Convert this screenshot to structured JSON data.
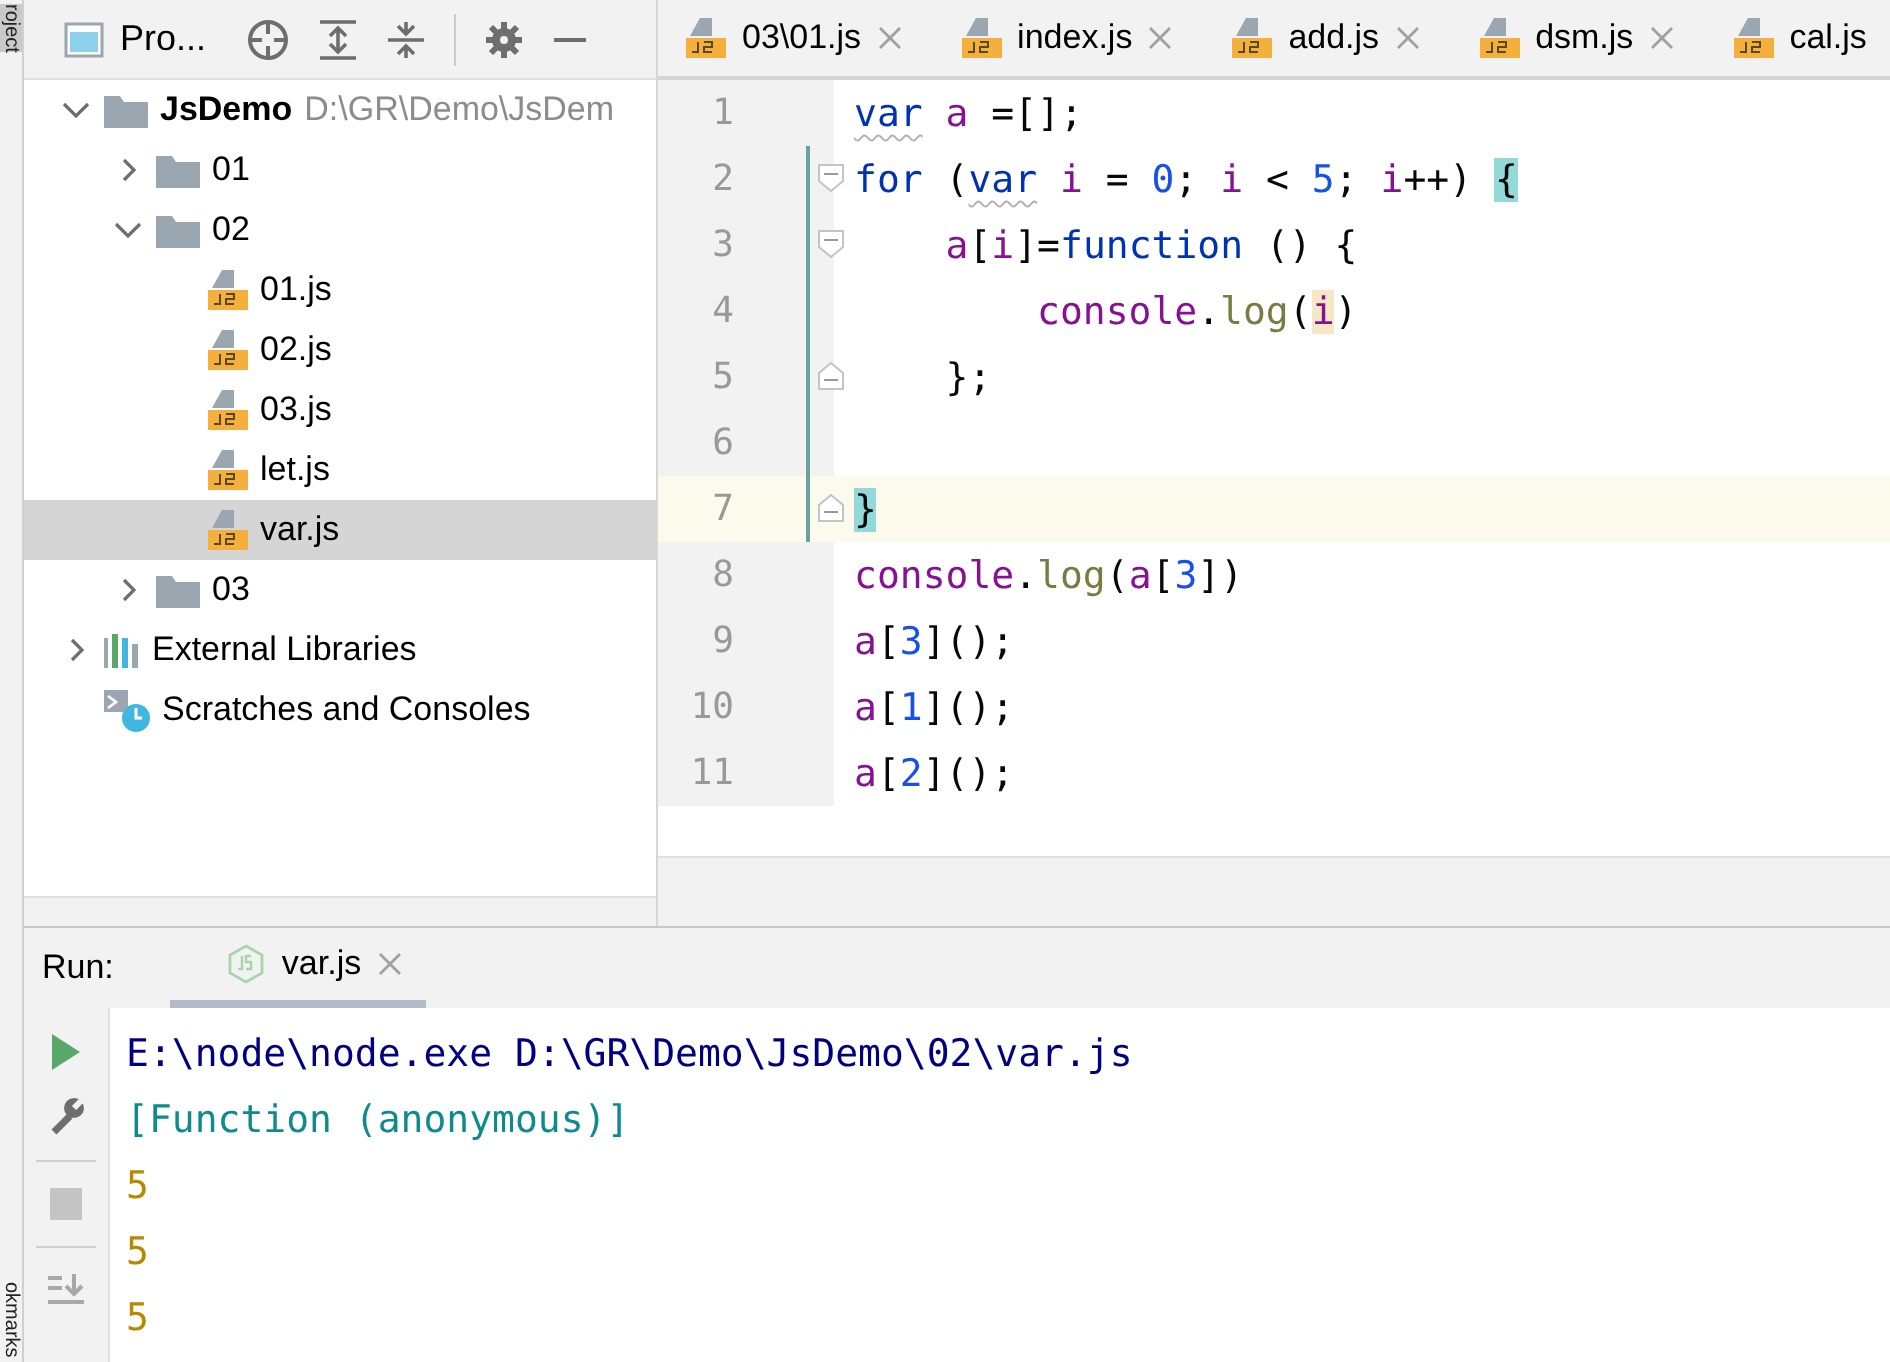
{
  "left_stripe": {
    "top_label": "roject",
    "bottom_label": "okmarks"
  },
  "project": {
    "title": "Pro...",
    "tree": [
      {
        "label": "JsDemo",
        "kind": "module",
        "path": "D:\\GR\\Demo\\JsDem",
        "expanded": true,
        "selected": false,
        "children": [
          {
            "label": "01",
            "kind": "folder",
            "expanded": false,
            "selected": false
          },
          {
            "label": "02",
            "kind": "folder",
            "expanded": true,
            "selected": false,
            "children": [
              {
                "label": "01.js",
                "kind": "js",
                "selected": false
              },
              {
                "label": "02.js",
                "kind": "js",
                "selected": false
              },
              {
                "label": "03.js",
                "kind": "js",
                "selected": false
              },
              {
                "label": "let.js",
                "kind": "js",
                "selected": false
              },
              {
                "label": "var.js",
                "kind": "js",
                "selected": true
              }
            ]
          },
          {
            "label": "03",
            "kind": "folder",
            "expanded": false,
            "selected": false
          }
        ]
      },
      {
        "label": "External Libraries",
        "kind": "libraries",
        "expanded": false,
        "selected": false
      },
      {
        "label": "Scratches and Consoles",
        "kind": "scratches",
        "selected": false
      }
    ]
  },
  "editor": {
    "tabs": [
      {
        "label": "03\\01.js",
        "closable": true
      },
      {
        "label": "index.js",
        "closable": true
      },
      {
        "label": "add.js",
        "closable": true
      },
      {
        "label": "dsm.js",
        "closable": true
      },
      {
        "label": "cal.js",
        "closable": false
      }
    ],
    "lines": [
      {
        "number": "1",
        "current": false,
        "changed": false,
        "tokens": [
          {
            "text": "var",
            "kind": "keyword",
            "warn": true
          },
          {
            "text": " a",
            "kind": "variable"
          },
          {
            "text": " =[];",
            "kind": "plain"
          }
        ]
      },
      {
        "number": "2",
        "current": false,
        "changed": true,
        "fold_open": true,
        "tokens": [
          {
            "text": "for",
            "kind": "keyword"
          },
          {
            "text": " (",
            "kind": "plain"
          },
          {
            "text": "var",
            "kind": "keyword",
            "warn": true
          },
          {
            "text": " i",
            "kind": "variable"
          },
          {
            "text": " = ",
            "kind": "plain"
          },
          {
            "text": "0",
            "kind": "number"
          },
          {
            "text": "; ",
            "kind": "plain"
          },
          {
            "text": "i",
            "kind": "variable"
          },
          {
            "text": " < ",
            "kind": "plain"
          },
          {
            "text": "5",
            "kind": "number"
          },
          {
            "text": "; ",
            "kind": "plain"
          },
          {
            "text": "i",
            "kind": "variable"
          },
          {
            "text": "++) ",
            "kind": "plain"
          },
          {
            "text": "{",
            "kind": "plain",
            "brace_match": true
          }
        ]
      },
      {
        "number": "3",
        "current": false,
        "changed": true,
        "fold_open": true,
        "tokens": [
          {
            "text": "    a",
            "kind": "variable"
          },
          {
            "text": "[",
            "kind": "plain"
          },
          {
            "text": "i",
            "kind": "variable"
          },
          {
            "text": "]=",
            "kind": "plain"
          },
          {
            "text": "function",
            "kind": "keyword"
          },
          {
            "text": " () {",
            "kind": "plain"
          }
        ]
      },
      {
        "number": "4",
        "current": false,
        "changed": true,
        "tokens": [
          {
            "text": "        console",
            "kind": "variable"
          },
          {
            "text": ".",
            "kind": "plain"
          },
          {
            "text": "log",
            "kind": "method"
          },
          {
            "text": "(",
            "kind": "plain"
          },
          {
            "text": "i",
            "kind": "variable",
            "usage_highlight": true
          },
          {
            "text": ")",
            "kind": "plain"
          }
        ]
      },
      {
        "number": "5",
        "current": false,
        "changed": true,
        "fold_close": true,
        "tokens": [
          {
            "text": "    };",
            "kind": "plain"
          }
        ]
      },
      {
        "number": "6",
        "current": false,
        "changed": true
      },
      {
        "number": "7",
        "current": true,
        "changed": true,
        "fold_close": true,
        "tokens": [
          {
            "text": "}",
            "kind": "plain",
            "brace_match": true
          }
        ]
      },
      {
        "number": "8",
        "current": false,
        "changed": false,
        "tokens": [
          {
            "text": "console",
            "kind": "variable"
          },
          {
            "text": ".",
            "kind": "plain"
          },
          {
            "text": "log",
            "kind": "method"
          },
          {
            "text": "(",
            "kind": "plain"
          },
          {
            "text": "a",
            "kind": "variable"
          },
          {
            "text": "[",
            "kind": "plain"
          },
          {
            "text": "3",
            "kind": "number"
          },
          {
            "text": "])",
            "kind": "plain"
          }
        ]
      },
      {
        "number": "9",
        "current": false,
        "changed": false,
        "tokens": [
          {
            "text": "a",
            "kind": "variable"
          },
          {
            "text": "[",
            "kind": "plain"
          },
          {
            "text": "3",
            "kind": "number"
          },
          {
            "text": "]();",
            "kind": "plain"
          }
        ]
      },
      {
        "number": "10",
        "current": false,
        "changed": false,
        "tokens": [
          {
            "text": "a",
            "kind": "variable"
          },
          {
            "text": "[",
            "kind": "plain"
          },
          {
            "text": "1",
            "kind": "number"
          },
          {
            "text": "]();",
            "kind": "plain"
          }
        ]
      },
      {
        "number": "11",
        "current": false,
        "changed": false,
        "tokens": [
          {
            "text": "a",
            "kind": "variable"
          },
          {
            "text": "[",
            "kind": "plain"
          },
          {
            "text": "2",
            "kind": "number"
          },
          {
            "text": "]();",
            "kind": "plain"
          }
        ]
      }
    ]
  },
  "run": {
    "label": "Run:",
    "tabs": [
      {
        "label": "var.js",
        "selected": true
      }
    ],
    "output": [
      {
        "text": "E:\\node\\node.exe D:\\GR\\Demo\\JsDemo\\02\\var.js",
        "kind": "command"
      },
      {
        "text": "[Function (anonymous)]",
        "kind": "result"
      },
      {
        "text": "5",
        "kind": "log"
      },
      {
        "text": "5",
        "kind": "log"
      },
      {
        "text": "5",
        "kind": "log"
      }
    ]
  }
}
